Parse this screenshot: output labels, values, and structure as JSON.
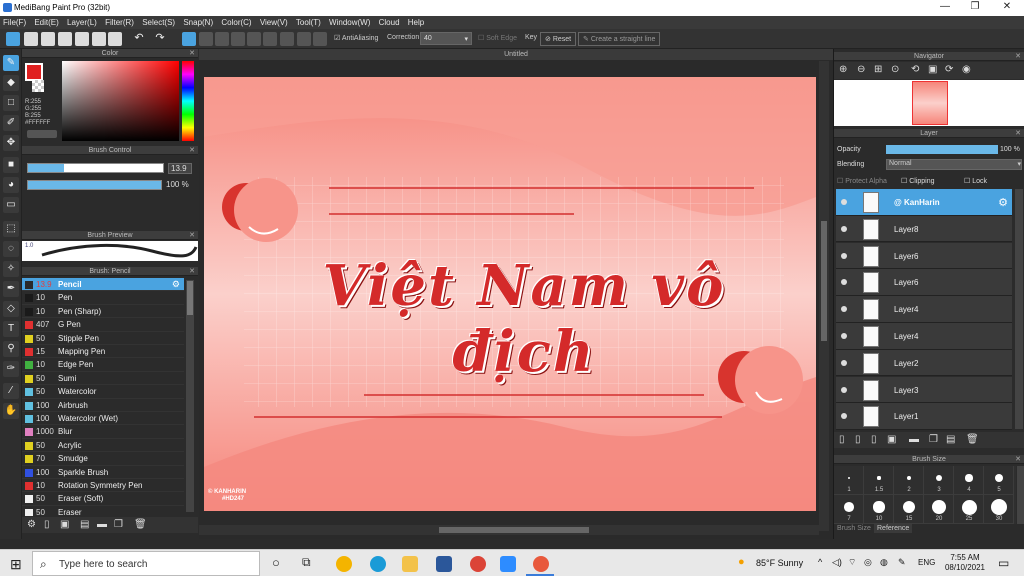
{
  "window": {
    "title": "MediBang Paint Pro (32bit)",
    "minimize": "—",
    "restore": "❐",
    "close": "✕"
  },
  "menu": [
    "File(F)",
    "Edit(E)",
    "Layer(L)",
    "Filter(R)",
    "Select(S)",
    "Snap(N)",
    "Color(C)",
    "View(V)",
    "Tool(T)",
    "Window(W)",
    "Cloud",
    "Help"
  ],
  "toolbar": {
    "antialiasing": "AntiAliasing",
    "correction_label": "Correction",
    "correction_value": "40",
    "soft_edge": "Soft Edge",
    "key_label": "Key",
    "reset": "Reset",
    "straight_line": "Create a straight line"
  },
  "panels": {
    "color": "Color",
    "brush_control": "Brush Control",
    "brush_preview": "Brush Preview",
    "brush_list": "Brush: Pencil",
    "navigator": "Navigator",
    "layer": "Layer",
    "brush_size": "Brush Size",
    "reference": "Reference",
    "close_icon": "✕",
    "undock_icon": "⧉"
  },
  "color_panel": {
    "r": "R:255",
    "g": "G:255",
    "b": "B:255",
    "hex": "#FFFFFF",
    "main_color": "#e02020"
  },
  "brush_control": {
    "size": "13.9",
    "opacity": "100 %"
  },
  "brush_preview_value": "1.0",
  "brushes": [
    {
      "size": "13.9",
      "name": "Pencil",
      "color": "#2a2a2a"
    },
    {
      "size": "10",
      "name": "Pen",
      "color": "#1a1a1a"
    },
    {
      "size": "10",
      "name": "Pen (Sharp)",
      "color": "#1a1a1a"
    },
    {
      "size": "407",
      "name": "G Pen",
      "color": "#e03030"
    },
    {
      "size": "50",
      "name": "Stipple Pen",
      "color": "#e0d020"
    },
    {
      "size": "15",
      "name": "Mapping Pen",
      "color": "#e03030"
    },
    {
      "size": "10",
      "name": "Edge Pen",
      "color": "#40b040"
    },
    {
      "size": "50",
      "name": "Sumi",
      "color": "#e0d020"
    },
    {
      "size": "50",
      "name": "Watercolor",
      "color": "#60c0e0"
    },
    {
      "size": "100",
      "name": "Airbrush",
      "color": "#60c0e0"
    },
    {
      "size": "100",
      "name": "Watercolor (Wet)",
      "color": "#60c0e0"
    },
    {
      "size": "1000",
      "name": "Blur",
      "color": "#e080c0"
    },
    {
      "size": "50",
      "name": "Acrylic",
      "color": "#e0d020"
    },
    {
      "size": "70",
      "name": "Smudge",
      "color": "#e0d020"
    },
    {
      "size": "100",
      "name": "Sparkle Brush",
      "color": "#3050e0"
    },
    {
      "size": "10",
      "name": "Rotation Symmetry Pen",
      "color": "#e03030"
    },
    {
      "size": "50",
      "name": "Eraser (Soft)",
      "color": "#f0f0f0"
    },
    {
      "size": "50",
      "name": "Eraser",
      "color": "#f0f0f0"
    }
  ],
  "canvas": {
    "tab_title": "Untitled",
    "art_text": "Việt Nam vô địch",
    "signature_line1": "© KANHARIN",
    "signature_line2": "#HD247"
  },
  "layer_panel": {
    "opacity_label": "Opacity",
    "opacity_value": "100 %",
    "blending_label": "Blending",
    "blending_value": "Normal",
    "protect_alpha": "Protect Alpha",
    "clipping": "Clipping",
    "lock": "Lock",
    "layers": [
      "@ KanHarin",
      "Layer8",
      "Layer6",
      "Layer6",
      "Layer4",
      "Layer4",
      "Layer2",
      "Layer3",
      "Layer1"
    ]
  },
  "brush_sizes": [
    "1",
    "1.5",
    "2",
    "3",
    "4",
    "5",
    "7",
    "10",
    "15",
    "20",
    "25",
    "30"
  ],
  "taskbar": {
    "search_placeholder": "Type here to search",
    "weather": "85°F  Sunny",
    "lang": "ENG",
    "time": "7:55 AM",
    "date": "08/10/2021"
  }
}
